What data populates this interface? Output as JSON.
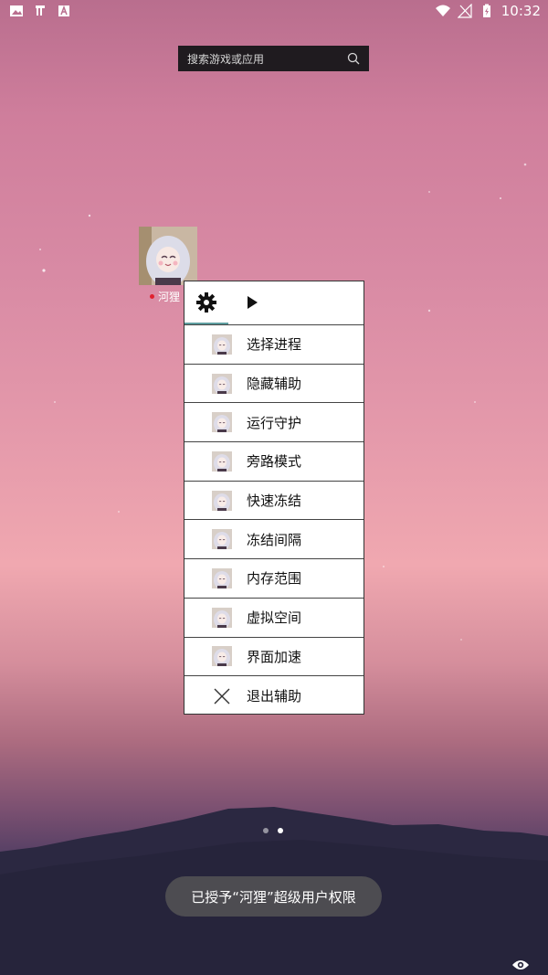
{
  "status_bar": {
    "left_icons": [
      "image-icon",
      "app-notification-icon",
      "a-badge-icon"
    ],
    "right_icons": [
      "wifi-icon",
      "no-signal-icon",
      "battery-charging-icon"
    ],
    "time": "10:32"
  },
  "search": {
    "placeholder": "搜索游戏或应用",
    "icon": "search-icon"
  },
  "app_icon": {
    "label": "河狸"
  },
  "menu": {
    "tabs": [
      {
        "icon": "gear-icon",
        "selected": true
      },
      {
        "icon": "play-icon",
        "selected": false
      }
    ],
    "items": [
      {
        "label": "选择进程",
        "icon": "avatar-icon"
      },
      {
        "label": "隐藏辅助",
        "icon": "avatar-icon"
      },
      {
        "label": "运行守护",
        "icon": "avatar-icon"
      },
      {
        "label": "旁路模式",
        "icon": "avatar-icon"
      },
      {
        "label": "快速冻结",
        "icon": "avatar-icon"
      },
      {
        "label": "冻结间隔",
        "icon": "avatar-icon"
      },
      {
        "label": "内存范围",
        "icon": "avatar-icon"
      },
      {
        "label": "虚拟空间",
        "icon": "avatar-icon"
      },
      {
        "label": "界面加速",
        "icon": "avatar-icon"
      },
      {
        "label": "退出辅助",
        "icon": "close-icon"
      }
    ]
  },
  "page_indicator": {
    "count": 2,
    "active": 2
  },
  "toast": {
    "text": "已授予“河狸”超级用户权限"
  },
  "colors": {
    "accent": "#5f9ea0",
    "toast_bg": "#505054",
    "search_bg": "#1f1b1f"
  }
}
